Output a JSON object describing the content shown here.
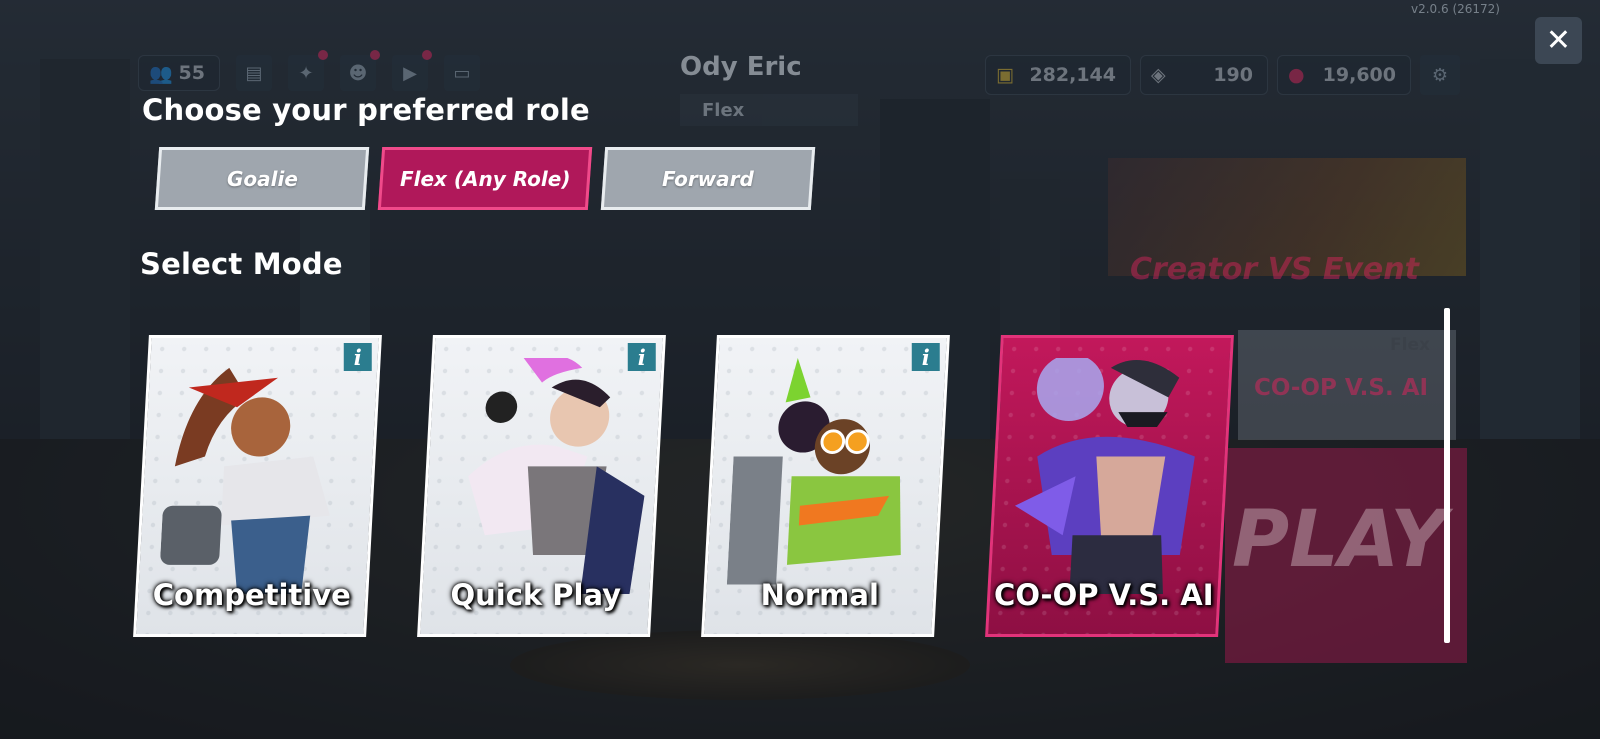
{
  "version": "v2.0.6 (26172)",
  "hud": {
    "friends_count": "55",
    "player_name": "Ody Eric",
    "player_role": "Flex",
    "currency_gold": "282,144",
    "currency_tickets": "190",
    "currency_gems": "19,600"
  },
  "role_section": {
    "heading": "Choose your preferred role",
    "roles": [
      "Goalie",
      "Flex (Any Role)",
      "Forward"
    ],
    "selected": "Flex (Any Role)"
  },
  "mode_section": {
    "heading": "Select Mode",
    "modes": [
      {
        "label": "Competitive",
        "has_info": true
      },
      {
        "label": "Quick Play",
        "has_info": true
      },
      {
        "label": "Normal",
        "has_info": true
      },
      {
        "label": "CO-OP V.S. AI",
        "has_info": false,
        "selected": true
      }
    ]
  },
  "background": {
    "event_title": "Creator VS Event",
    "side_mode": "CO-OP V.S. AI",
    "side_role": "Flex",
    "play_label": "PLAY"
  },
  "icons": {
    "close": "close-icon",
    "info": "info-icon",
    "settings": "gear-icon"
  },
  "colors": {
    "accent_pink": "#b0185a",
    "info_teal": "#2b7d8f",
    "inactive_grey": "#9fa6ae"
  }
}
